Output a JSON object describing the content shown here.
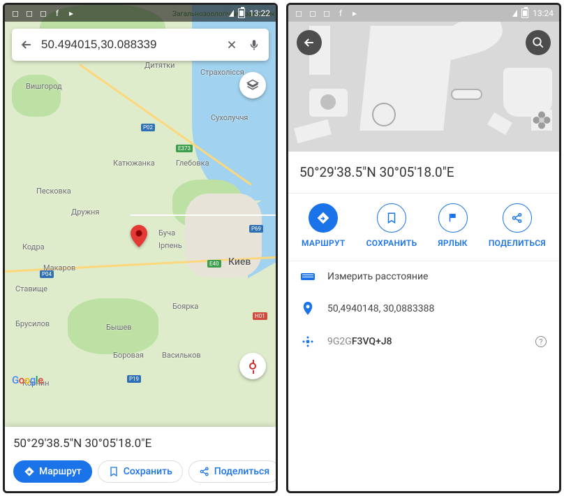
{
  "left": {
    "status": {
      "time": "13:22"
    },
    "search": {
      "value": "50.494015,30.088339"
    },
    "map_labels": {
      "reserve": "Загальнозоологічний заказник",
      "dityatki": "Дитятки",
      "strakholissya": "Страхолісся",
      "vyshgorod": "Вишгород",
      "sukholuchya": "Сухолуччя",
      "katyuzhanka": "Катюжанка",
      "glebovka": "Глебовка",
      "peskovka": "Песковка",
      "druzhnya": "Дружня",
      "kodra": "Кодра",
      "bucha": "Буча",
      "irpin": "Ірпень",
      "makarov": "Макаров",
      "kiev": "Киев",
      "stavishche": "Ставище",
      "boyarka": "Боярка",
      "brusilov": "Брусилов",
      "byshev": "Бышев",
      "borova": "Боровая",
      "vasylkiv": "Васильков",
      "kornin": "Корнин"
    },
    "road_labels": {
      "p02": "Р02",
      "e40": "Е40",
      "p04": "Р04",
      "p19": "Р19",
      "e373": "Е373",
      "p69": "Р69",
      "n01": "Н01"
    },
    "google": [
      "G",
      "o",
      "o",
      "g",
      "l",
      "e"
    ],
    "bottom": {
      "coord_dms": "50°29'38.5\"N 30°05'18.0\"E",
      "route": "Маршрут",
      "save": "Сохранить",
      "share": "Поделиться"
    }
  },
  "right": {
    "status": {
      "time": "13:24"
    },
    "title": "50°29'38.5\"N 30°05'18.0\"E",
    "actions": {
      "route": "МАРШРУТ",
      "save": "СОХРАНИТЬ",
      "label": "ЯРЛЫК",
      "share": "ПОДЕЛИТЬСЯ"
    },
    "measure": "Измерить расстояние",
    "coord_dec": "50,4940148, 30,0883388",
    "plus_code_prefix": "9G2G",
    "plus_code_suffix": "F3VQ+J8"
  }
}
